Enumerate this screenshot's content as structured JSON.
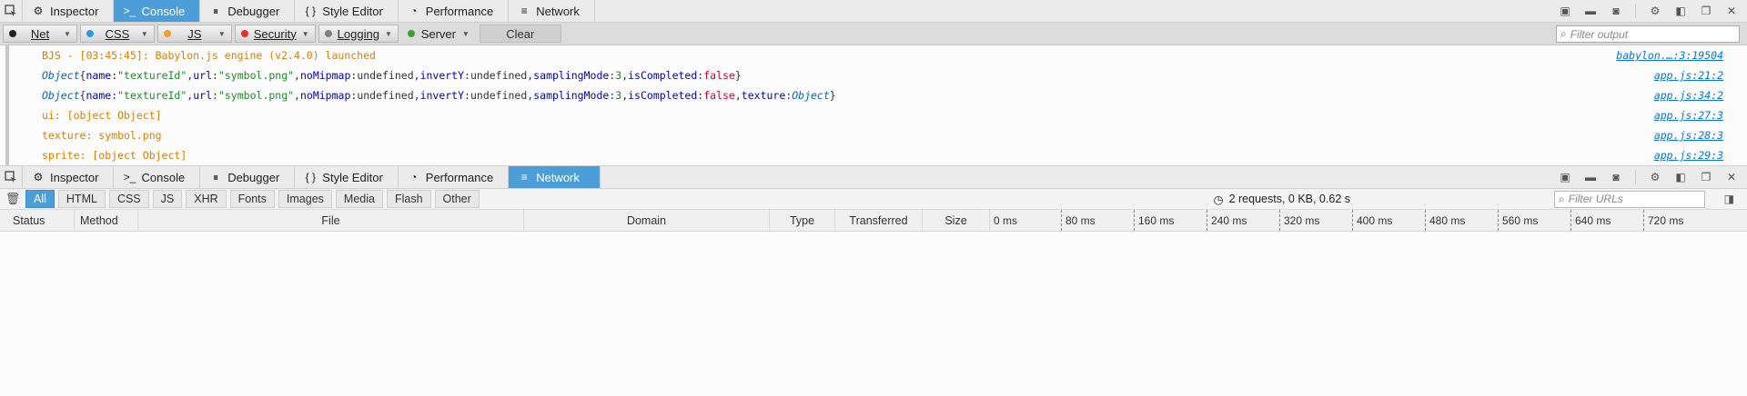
{
  "toolbox": {
    "tabs": [
      {
        "label": "Inspector",
        "icon": "inspector-icon",
        "glyph": "⚙"
      },
      {
        "label": "Console",
        "icon": "console-icon",
        "glyph": ">_"
      },
      {
        "label": "Debugger",
        "icon": "debugger-icon",
        "glyph": "⏸"
      },
      {
        "label": "Style Editor",
        "icon": "style-editor-icon",
        "glyph": "{ }"
      },
      {
        "label": "Performance",
        "icon": "performance-icon",
        "glyph": "◔"
      },
      {
        "label": "Network",
        "icon": "network-icon",
        "glyph": "≡"
      }
    ]
  },
  "console": {
    "filters": [
      {
        "label": "Net",
        "color": "#222222"
      },
      {
        "label": "CSS",
        "color": "#2b9be0"
      },
      {
        "label": "JS",
        "color": "#f0a020"
      },
      {
        "label": "Security",
        "color": "#e03030"
      },
      {
        "label": "Logging",
        "color": "#808080"
      },
      {
        "label": "Server",
        "color": "#3aa030"
      }
    ],
    "clear_label": "Clear",
    "filter_placeholder": "Filter output",
    "messages": [
      {
        "text": "BJS - [03:45:45]: Babylon.js engine (v2.4.0) launched",
        "source": "babylon.…:3:19504"
      },
      {
        "parts": [
          "Object",
          " { ",
          "name",
          ": ",
          "\"textureId\"",
          ", ",
          "url",
          ": ",
          "\"symbol.png\"",
          ", ",
          "noMipmap",
          ": ",
          "undefined",
          ", ",
          "invertY",
          ": ",
          "undefined",
          ", ",
          "samplingMode",
          ": ",
          "3",
          ", ",
          "isCompleted",
          ": ",
          "false",
          " }"
        ],
        "source": "app.js:21:2"
      },
      {
        "parts": [
          "Object",
          " { ",
          "name",
          ": ",
          "\"textureId\"",
          ", ",
          "url",
          ": ",
          "\"symbol.png\"",
          ", ",
          "noMipmap",
          ": ",
          "undefined",
          ", ",
          "invertY",
          ": ",
          "undefined",
          ", ",
          "samplingMode",
          ": ",
          "3",
          ", ",
          "isCompleted",
          ": ",
          "false",
          ", ",
          "texture",
          ": ",
          "Object",
          " }"
        ],
        "source": "app.js:34:2"
      },
      {
        "text": "ui: [object Object]",
        "source": "app.js:27:3"
      },
      {
        "text": "texture: symbol.png",
        "source": "app.js:28:3"
      },
      {
        "text": "sprite: [object Object]",
        "source": "app.js:29:3"
      }
    ]
  },
  "network": {
    "filter_tabs": [
      "All",
      "HTML",
      "CSS",
      "JS",
      "XHR",
      "Fonts",
      "Images",
      "Media",
      "Flash",
      "Other"
    ],
    "summary": "2 requests, 0 KB, 0.62 s",
    "url_filter_placeholder": "Filter URLs",
    "columns": [
      "Status",
      "Method",
      "File",
      "Domain",
      "Type",
      "Transferred",
      "Size"
    ],
    "ticks": [
      "0 ms",
      "80 ms",
      "160 ms",
      "240 ms",
      "320 ms",
      "400 ms",
      "480 ms",
      "560 ms",
      "640 ms",
      "720 ms"
    ]
  }
}
